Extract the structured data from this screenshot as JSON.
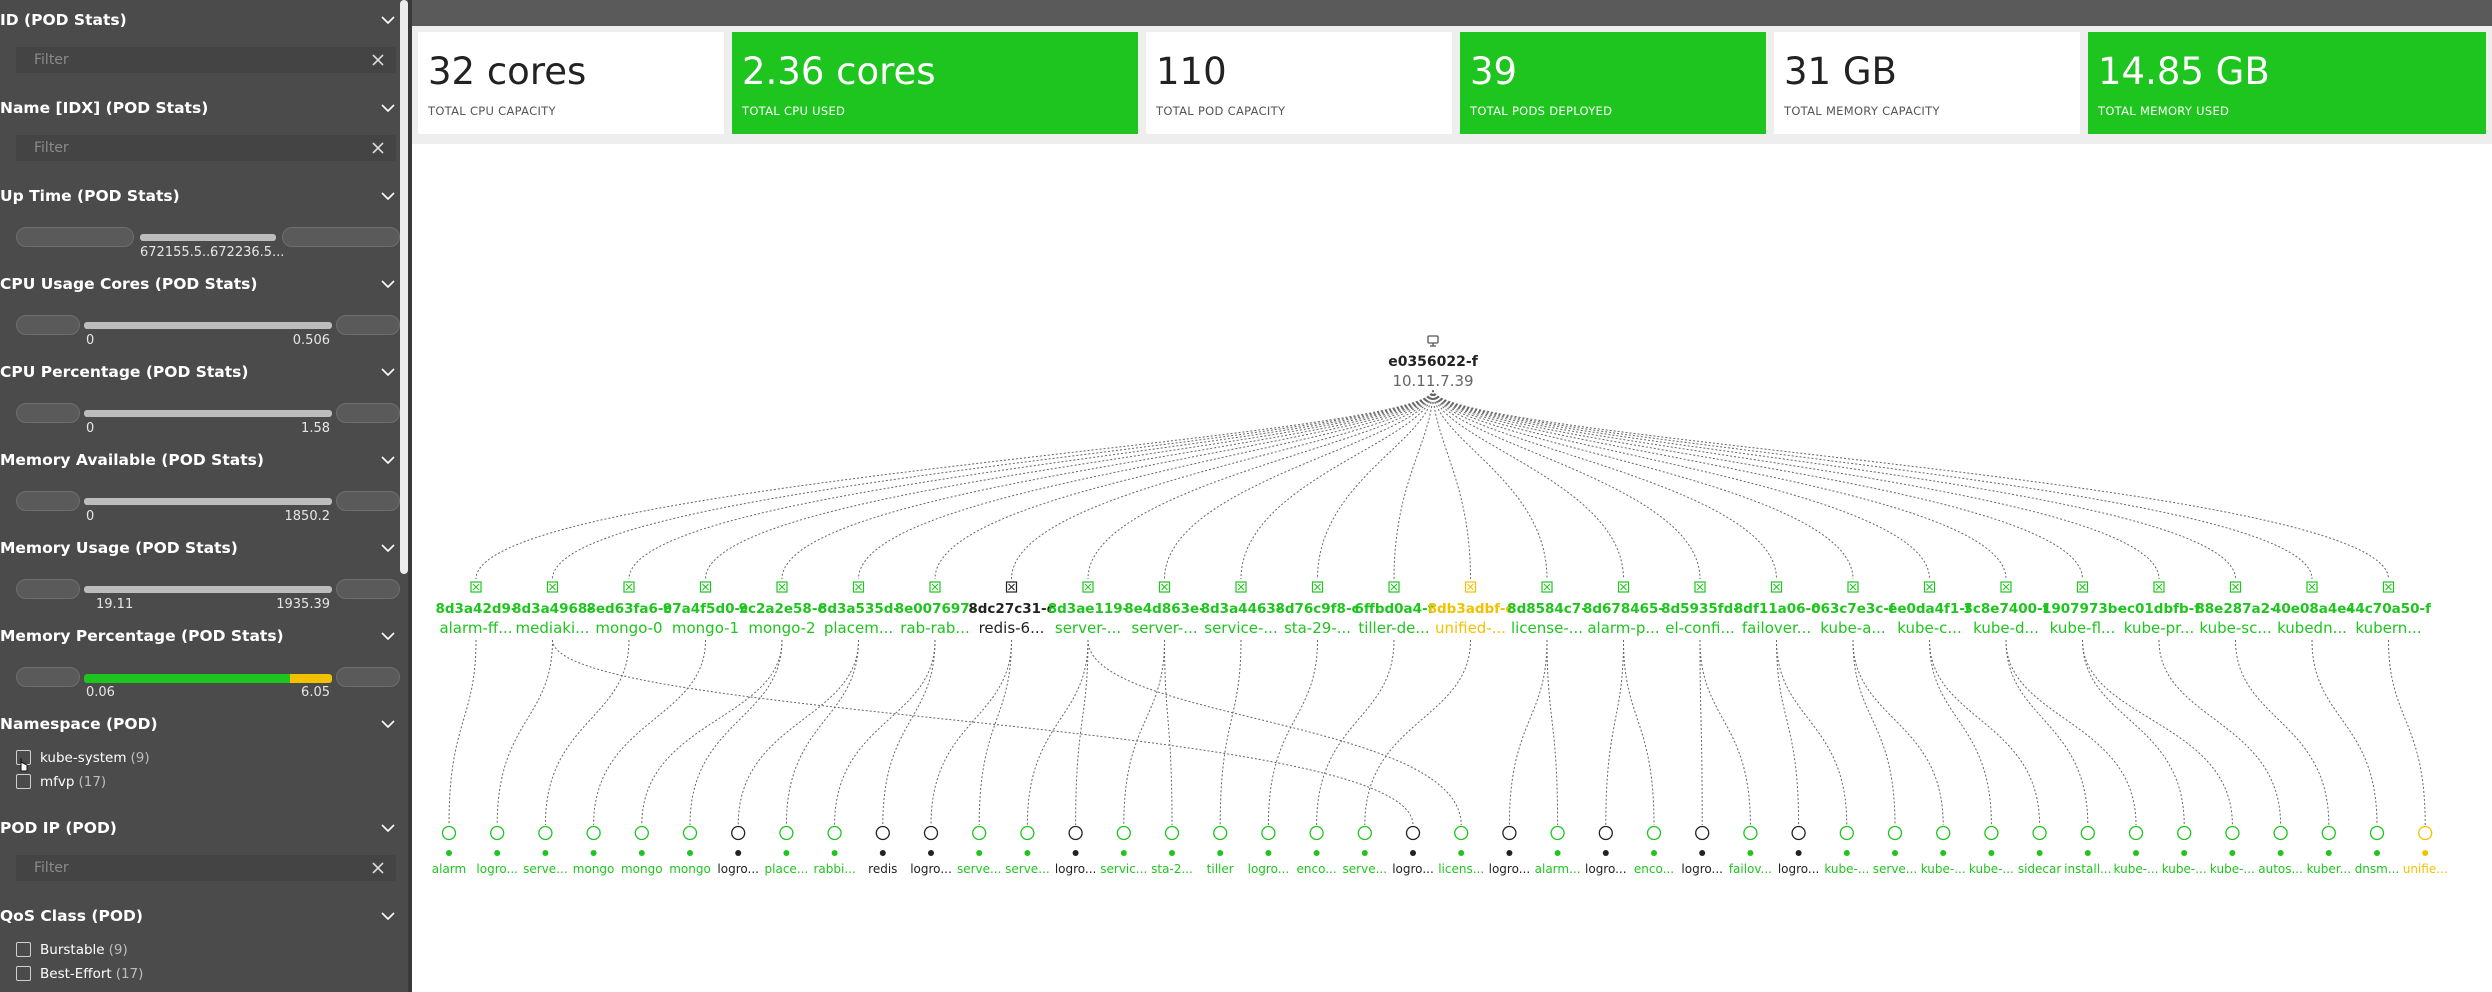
{
  "colors": {
    "green": "#1ec51e",
    "yellow": "#f2c200",
    "dark": "#222222",
    "gray": "#555555"
  },
  "sidebar": {
    "sections": [
      {
        "title": "ID (POD Stats)",
        "kind": "filter",
        "placeholder": "Filter"
      },
      {
        "title": "Name [IDX] (POD Stats)",
        "kind": "filter",
        "placeholder": "Filter"
      },
      {
        "title": "Up Time (POD Stats)",
        "kind": "range",
        "min": "672155.5...",
        "max": "672236.5..."
      },
      {
        "title": "CPU Usage Cores (POD Stats)",
        "kind": "range",
        "min": "0",
        "max": "0.506"
      },
      {
        "title": "CPU Percentage (POD Stats)",
        "kind": "range",
        "min": "0",
        "max": "1.58"
      },
      {
        "title": "Memory Available (POD Stats)",
        "kind": "range",
        "min": "0",
        "max": "1850.2"
      },
      {
        "title": "Memory Usage (POD Stats)",
        "kind": "range",
        "min": "19.11",
        "max": "1935.39"
      },
      {
        "title": "Memory Percentage (POD Stats)",
        "kind": "range",
        "min": "0.06",
        "max": "6.05"
      },
      {
        "title": "Namespace (POD)",
        "kind": "checks",
        "items": [
          {
            "label": "kube-system",
            "count": "(9)"
          },
          {
            "label": "mfvp",
            "count": "(17)"
          }
        ]
      },
      {
        "title": "POD IP (POD)",
        "kind": "filter",
        "placeholder": "Filter"
      },
      {
        "title": "QoS Class (POD)",
        "kind": "checks",
        "items": [
          {
            "label": "Burstable",
            "count": "(9)"
          },
          {
            "label": "Best-Effort",
            "count": "(17)"
          }
        ]
      }
    ]
  },
  "kpis": [
    {
      "value": "32 cores",
      "label": "TOTAL CPU CAPACITY",
      "style": "white"
    },
    {
      "value": "2.36 cores",
      "label": "TOTAL CPU USED",
      "style": "green"
    },
    {
      "value": "110",
      "label": "TOTAL POD CAPACITY",
      "style": "white"
    },
    {
      "value": "39",
      "label": "TOTAL PODS DEPLOYED",
      "style": "green"
    },
    {
      "value": "31 GB",
      "label": "TOTAL MEMORY CAPACITY",
      "style": "white"
    },
    {
      "value": "14.85 GB",
      "label": "TOTAL MEMORY USED",
      "style": "green"
    }
  ],
  "topology": {
    "root": {
      "id": "e0356022-f",
      "ip": "10.11.7.39",
      "icon": "server-icon"
    },
    "pods": [
      {
        "id": "8d3a42d9-",
        "name": "alarm-ff...",
        "status": "green"
      },
      {
        "id": "8d3a4968-",
        "name": "mediaki...",
        "status": "green"
      },
      {
        "id": "8ed63fa6-c",
        "name": "mongo-0",
        "status": "green"
      },
      {
        "id": "97a4f5d0-c",
        "name": "mongo-1",
        "status": "green"
      },
      {
        "id": "9c2a2e58-c",
        "name": "mongo-2",
        "status": "green"
      },
      {
        "id": "8d3a535d-",
        "name": "placem...",
        "status": "green"
      },
      {
        "id": "8e007697-",
        "name": "rab-rab...",
        "status": "green"
      },
      {
        "id": "8dc27c31-c",
        "name": "redis-6...",
        "status": "dark"
      },
      {
        "id": "8d3ae119-",
        "name": "server-...",
        "status": "green"
      },
      {
        "id": "8e4d863e-",
        "name": "server-...",
        "status": "green"
      },
      {
        "id": "8d3a4463-",
        "name": "service-...",
        "status": "green"
      },
      {
        "id": "8d76c9f8-c",
        "name": "sta-29-...",
        "status": "green"
      },
      {
        "id": "6ffbd0a4-f",
        "name": "tiller-de...",
        "status": "green"
      },
      {
        "id": "8db3adbf-c",
        "name": "unified-...",
        "status": "yellow"
      },
      {
        "id": "8d8584c7-",
        "name": "license-...",
        "status": "green"
      },
      {
        "id": "8d678465-",
        "name": "alarm-p...",
        "status": "green"
      },
      {
        "id": "8d5935fd-",
        "name": "el-confi...",
        "status": "green"
      },
      {
        "id": "8df11a06-c",
        "name": "failover...",
        "status": "green"
      },
      {
        "id": "063c7e3c-f",
        "name": "kube-a...",
        "status": "green"
      },
      {
        "id": "ee0da4f1-f",
        "name": "kube-c...",
        "status": "green"
      },
      {
        "id": "3c8e7400-f",
        "name": "kube-d...",
        "status": "green"
      },
      {
        "id": "1907973b-",
        "name": "kube-fl...",
        "status": "green"
      },
      {
        "id": "ec01dbfb-f",
        "name": "kube-pr...",
        "status": "green"
      },
      {
        "id": "88e287a2-",
        "name": "kube-sc...",
        "status": "green"
      },
      {
        "id": "40e08a4e-",
        "name": "kubedn...",
        "status": "green"
      },
      {
        "id": "44c70a50-f",
        "name": "kubern...",
        "status": "green"
      }
    ],
    "containers": [
      {
        "name": "alarm",
        "status": "green"
      },
      {
        "name": "logro...",
        "status": "green"
      },
      {
        "name": "serve...",
        "status": "green"
      },
      {
        "name": "mongo",
        "status": "green"
      },
      {
        "name": "mongo",
        "status": "green"
      },
      {
        "name": "mongo",
        "status": "green"
      },
      {
        "name": "logro...",
        "status": "dark"
      },
      {
        "name": "place...",
        "status": "green"
      },
      {
        "name": "rabbi...",
        "status": "green"
      },
      {
        "name": "redis",
        "status": "dark"
      },
      {
        "name": "logro...",
        "status": "dark"
      },
      {
        "name": "serve...",
        "status": "green"
      },
      {
        "name": "serve...",
        "status": "green"
      },
      {
        "name": "logro...",
        "status": "dark"
      },
      {
        "name": "servic...",
        "status": "green"
      },
      {
        "name": "sta-2...",
        "status": "green"
      },
      {
        "name": "tiller",
        "status": "green"
      },
      {
        "name": "logro...",
        "status": "green"
      },
      {
        "name": "enco...",
        "status": "green"
      },
      {
        "name": "serve...",
        "status": "green"
      },
      {
        "name": "logro...",
        "status": "dark"
      },
      {
        "name": "licens...",
        "status": "green"
      },
      {
        "name": "logro...",
        "status": "dark"
      },
      {
        "name": "alarm...",
        "status": "green"
      },
      {
        "name": "logro...",
        "status": "dark"
      },
      {
        "name": "enco...",
        "status": "green"
      },
      {
        "name": "logro...",
        "status": "dark"
      },
      {
        "name": "failov...",
        "status": "green"
      },
      {
        "name": "logro...",
        "status": "dark"
      },
      {
        "name": "kube-...",
        "status": "green"
      },
      {
        "name": "serve...",
        "status": "green"
      },
      {
        "name": "kube-...",
        "status": "green"
      },
      {
        "name": "kube-...",
        "status": "green"
      },
      {
        "name": "sidecar",
        "status": "green"
      },
      {
        "name": "install...",
        "status": "green"
      },
      {
        "name": "kube-...",
        "status": "green"
      },
      {
        "name": "kube-...",
        "status": "green"
      },
      {
        "name": "kube-...",
        "status": "green"
      },
      {
        "name": "autos...",
        "status": "green"
      },
      {
        "name": "kuber...",
        "status": "green"
      },
      {
        "name": "dnsm...",
        "status": "green"
      },
      {
        "name": "unifie...",
        "status": "yellow"
      }
    ],
    "links": [
      0,
      1,
      2,
      3,
      4,
      4,
      5,
      5,
      6,
      6,
      7,
      7,
      8,
      8,
      9,
      9,
      10,
      11,
      12,
      13,
      1,
      8,
      14,
      14,
      15,
      15,
      16,
      16,
      17,
      17,
      18,
      18,
      19,
      19,
      20,
      20,
      21,
      21,
      22,
      23,
      24,
      25
    ]
  }
}
